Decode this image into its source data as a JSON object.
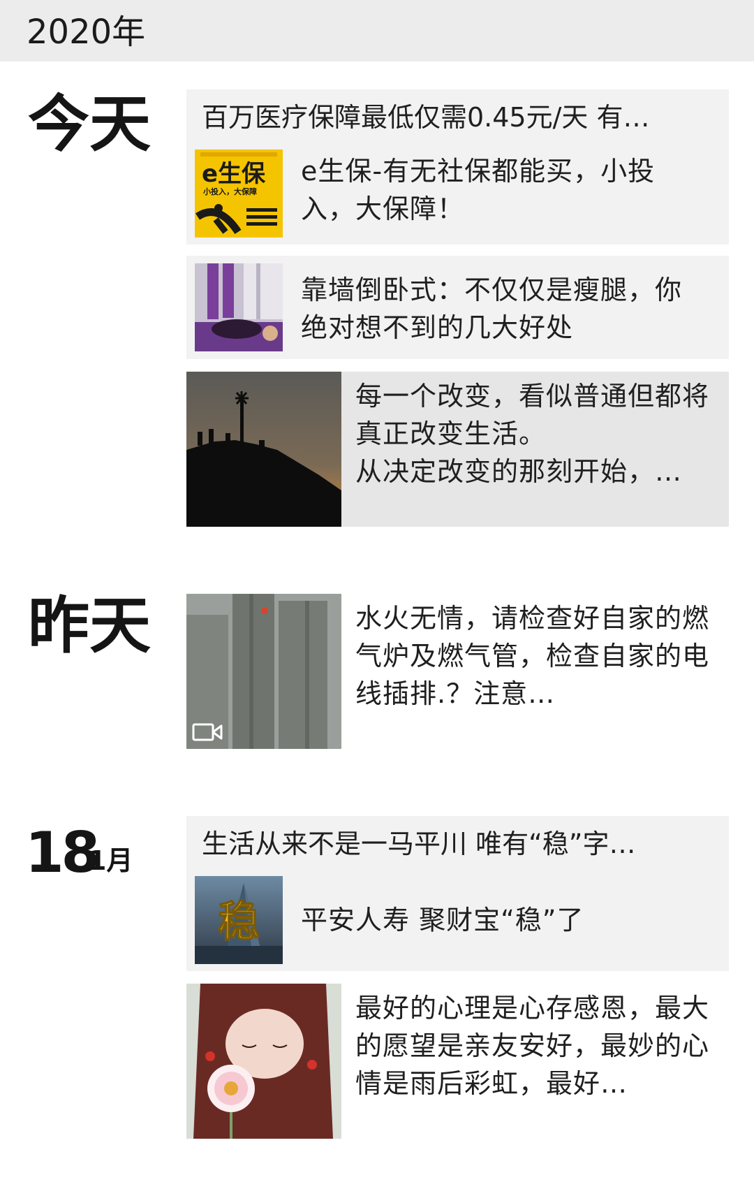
{
  "year_header": {
    "label": "2020年"
  },
  "groups": [
    {
      "day_label": "今天",
      "items": [
        {
          "title": "百万医疗保障最低仅需0.45元/天 有…",
          "link_text": "e生保-有无社保都能买，小投入，大保障！",
          "thumb_brand": "e生保",
          "thumb_slogan": "小投入，大保障"
        },
        {
          "link_text": "靠墙倒卧式：不仅仅是瘦腿，你绝对想不到的几大好处"
        },
        {
          "text": "每一个改变，看似普通但都将真正改变生活。\n从决定改变的那刻开始，…"
        }
      ]
    },
    {
      "day_label": "昨天",
      "items": [
        {
          "text": "水火无情，请检查好自家的燃气炉及燃气管，检查自家的电线插排.？注意…",
          "has_video": true,
          "video_icon": "video-camera-icon"
        }
      ]
    },
    {
      "date_day": "18",
      "date_month": "1月",
      "items": [
        {
          "title": "生活从来不是一马平川 唯有“稳”字…",
          "link_text": "平安人寿 聚财宝“稳”了",
          "thumb_char": "稳"
        },
        {
          "text": "最好的心理是心存感恩，最大的愿望是亲友安好，最妙的心情是雨后彩虹，最好…"
        }
      ]
    }
  ],
  "colors": {
    "header_bg": "#ececec",
    "card_bg": "#f2f2f2",
    "shaded_bg": "#e6e6e6",
    "brand_yellow": "#f5c400"
  }
}
